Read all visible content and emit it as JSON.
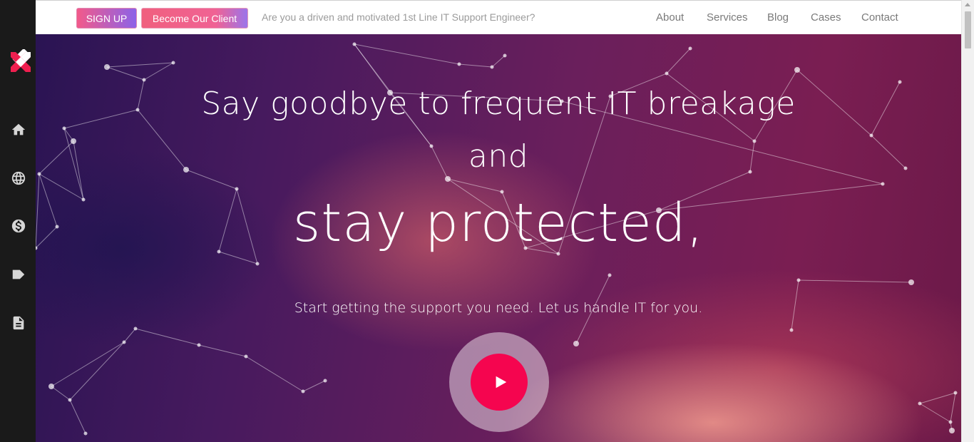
{
  "sidebar": {
    "logo": "x-logo-icon",
    "icons": [
      "home-icon",
      "globe-icon",
      "dollar-icon",
      "label-icon",
      "document-icon"
    ]
  },
  "topbar": {
    "signup_label": "SIGN UP",
    "client_label": "Become Our Client",
    "tagline": "Are you a driven and motivated 1st Line IT Support Engineer?",
    "nav": [
      "About",
      "Services",
      "Blog",
      "Cases",
      "Contact"
    ]
  },
  "hero": {
    "line1": "Say goodbye to frequent IT breakage",
    "line2": "and",
    "line3": "stay protected,",
    "subtitle": "Start getting the support you need. Let us handle IT for you.",
    "play_icon": "play-icon"
  },
  "colors": {
    "sidebar": "#1a1a1a",
    "play": "#f5054f",
    "signup_gradient": [
      "#f25a8a",
      "#8c63e8"
    ]
  }
}
